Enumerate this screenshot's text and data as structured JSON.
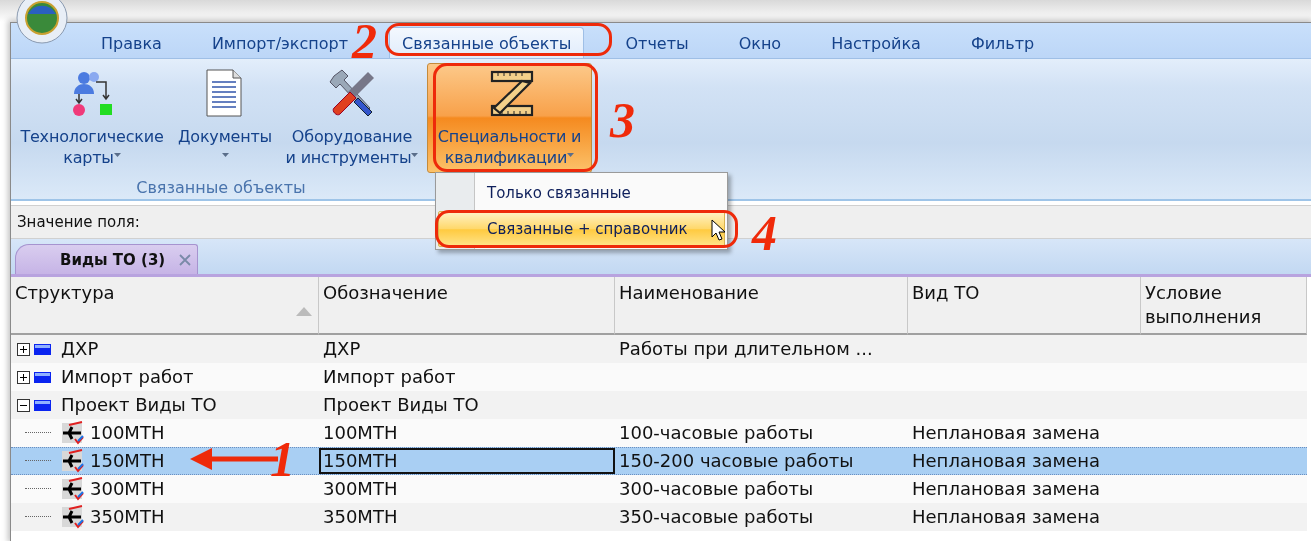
{
  "menu_tabs": [
    {
      "label": "Правка",
      "selected": false
    },
    {
      "label": "Импорт/экспорт",
      "selected": false
    },
    {
      "label": "Связанные объекты",
      "selected": true
    },
    {
      "label": "Отчеты",
      "selected": false
    },
    {
      "label": "Окно",
      "selected": false
    },
    {
      "label": "Настройка",
      "selected": false
    },
    {
      "label": "Фильтр",
      "selected": false
    }
  ],
  "ribbon": {
    "group_label": "Связанные объекты",
    "buttons": [
      {
        "kind": "routing",
        "lines": [
          "Технологические",
          "карты"
        ],
        "pressed": false
      },
      {
        "kind": "document",
        "lines": [
          "Документы"
        ],
        "pressed": false
      },
      {
        "kind": "tools",
        "lines": [
          "Оборудование",
          "и инструменты"
        ],
        "pressed": false
      },
      {
        "kind": "rulers",
        "lines": [
          "Специальности и",
          "квалификации"
        ],
        "pressed": true
      }
    ]
  },
  "dropdown_menu": {
    "items": [
      {
        "label": "Только связанные",
        "highlighted": false
      },
      {
        "label": "Связанные + справочник",
        "highlighted": true
      }
    ]
  },
  "field": {
    "label": "Значение поля:"
  },
  "document_tabs": [
    {
      "label": "Виды ТО (3)",
      "selected": true
    }
  ],
  "table": {
    "columns": [
      {
        "label": "Структура",
        "sorted": true
      },
      {
        "label": "Обозначение",
        "sorted": false
      },
      {
        "label": "Наименование",
        "sorted": false
      },
      {
        "label": "Вид ТО",
        "sorted": false
      },
      {
        "label": "Условие выполнения",
        "sorted": false
      }
    ],
    "rows": [
      {
        "structure": "ДХР",
        "designation": "ДХР",
        "name": "Работы при длительном ...",
        "expanded": false,
        "selected": false
      },
      {
        "structure": "Импорт работ",
        "designation": "Импорт работ",
        "expanded": false,
        "selected": false
      },
      {
        "structure": "Проект Виды ТО",
        "designation": "Проект Виды ТО",
        "expanded": true,
        "selected": false,
        "children": [
          {
            "structure": "100MTH",
            "designation": "100MTH",
            "name": "100-часовые работы",
            "type": "Неплановая замена",
            "selected": false
          },
          {
            "structure": "150MTH",
            "designation": "150MTH",
            "name": "150-200 часовые работы",
            "type": "Неплановая замена",
            "selected": true
          },
          {
            "structure": "300MTH",
            "designation": "300MTH",
            "name": "300-часовые работы",
            "type": "Неплановая замена",
            "selected": false
          },
          {
            "structure": "350MTH",
            "designation": "350MTH",
            "name": "350-часовые работы",
            "type": "Неплановая замена",
            "selected": false
          }
        ]
      }
    ]
  },
  "annotations": [
    {
      "label": "1",
      "kind": "arrow"
    },
    {
      "label": "2",
      "kind": "outline"
    },
    {
      "label": "3",
      "kind": "outline"
    },
    {
      "label": "4",
      "kind": "outline"
    }
  ]
}
